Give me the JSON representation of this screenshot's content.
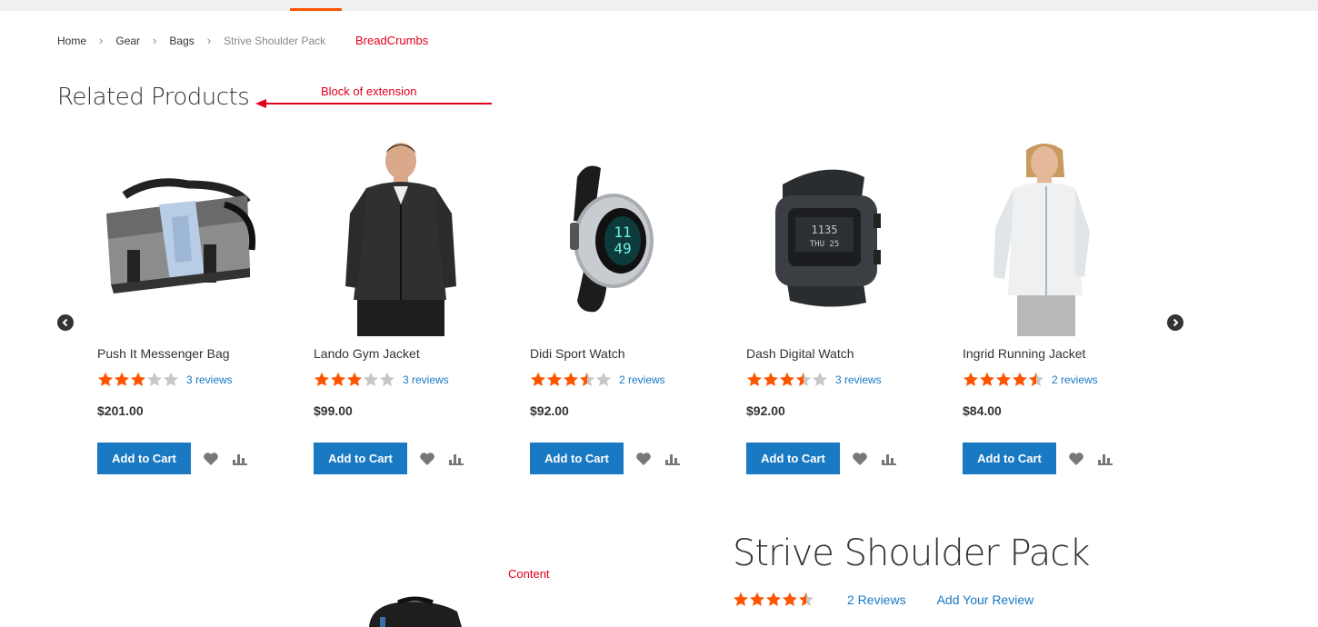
{
  "breadcrumbs": [
    "Home",
    "Gear",
    "Bags",
    "Strive Shoulder Pack"
  ],
  "annotations": {
    "breadcrumbs": "BreadCrumbs",
    "block": "Block of extension",
    "content": "Content"
  },
  "related": {
    "title": "Related Products",
    "products": [
      {
        "name": "Push It Messenger Bag",
        "rating": 3,
        "reviews": "3 reviews",
        "price": "$201.00",
        "button": "Add to Cart",
        "image": "messenger-bag"
      },
      {
        "name": "Lando Gym Jacket",
        "rating": 3,
        "reviews": "3 reviews",
        "price": "$99.00",
        "button": "Add to Cart",
        "image": "black-jacket"
      },
      {
        "name": "Didi Sport Watch",
        "rating": 3.5,
        "reviews": "2 reviews",
        "price": "$92.00",
        "button": "Add to Cart",
        "image": "sport-watch"
      },
      {
        "name": "Dash Digital Watch",
        "rating": 3.5,
        "reviews": "3 reviews",
        "price": "$92.00",
        "button": "Add to Cart",
        "image": "digital-watch"
      },
      {
        "name": "Ingrid Running Jacket",
        "rating": 4.5,
        "reviews": "2 reviews",
        "price": "$84.00",
        "button": "Add to Cart",
        "image": "white-jacket"
      }
    ]
  },
  "product": {
    "title": "Strive Shoulder Pack",
    "rating": 4.5,
    "reviews": "2 Reviews",
    "add_review": "Add Your Review"
  },
  "colors": {
    "accent": "#ff5501",
    "link": "#1979c3",
    "button": "#1979c3",
    "annotation": "#e0001b",
    "star_empty": "#c7c7c7"
  }
}
